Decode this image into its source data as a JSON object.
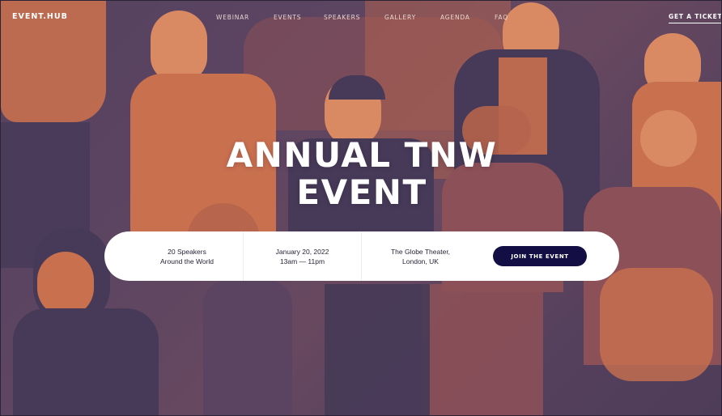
{
  "brand": {
    "logo": "EVENT.HUB"
  },
  "nav": {
    "links": [
      "WEBINAR",
      "EVENTS",
      "SPEAKERS",
      "GALLERY",
      "AGENDA",
      "FAQ"
    ],
    "cta": "GET A TICKET"
  },
  "hero": {
    "title_line1": "ANNUAL TNW",
    "title_line2": "EVENT"
  },
  "info": {
    "speakers_line1": "20 Speakers",
    "speakers_line2": "Around the World",
    "date_line1": "January 20, 2022",
    "date_line2": "13am — 11pm",
    "venue_line1": "The Globe Theater,",
    "venue_line2": "London, UK",
    "join_label": "JOIN THE EVENT"
  },
  "colors": {
    "photo_warm": "#c9704f",
    "photo_cool": "#463a58",
    "button": "#130f45",
    "bar": "#ffffff"
  }
}
